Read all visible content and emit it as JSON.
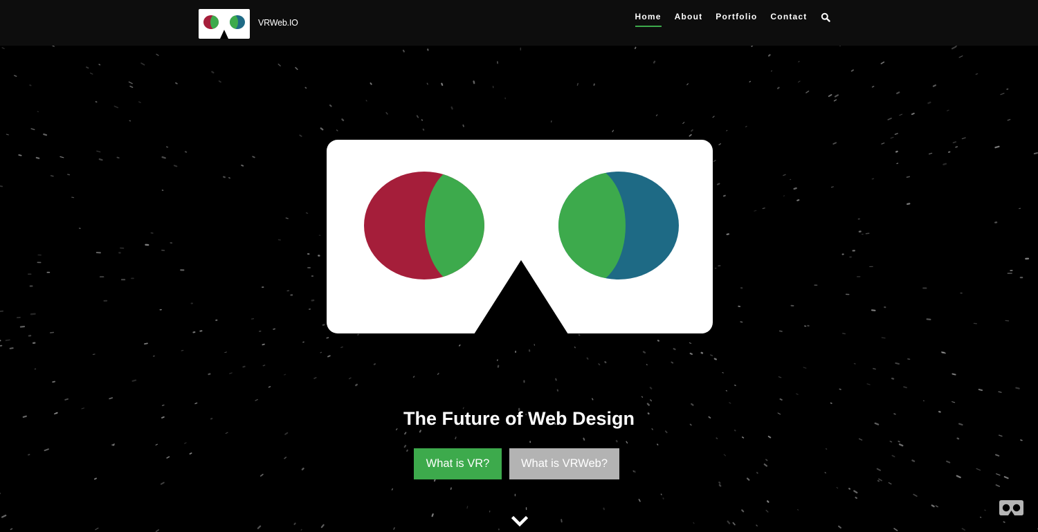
{
  "header": {
    "brand": "VRWeb.IO",
    "logo_icon": "vr-headset-logo-icon",
    "nav": [
      {
        "label": "Home",
        "active": true
      },
      {
        "label": "About",
        "active": false
      },
      {
        "label": "Portfolio",
        "active": false
      },
      {
        "label": "Contact",
        "active": false
      }
    ],
    "search_icon": "search-icon"
  },
  "hero": {
    "logo_icon": "vr-headset-logo-icon",
    "tagline": "The Future of Web Design",
    "buttons": [
      {
        "label": "What is VR?",
        "color": "#3daa4c"
      },
      {
        "label": "What is VRWeb?",
        "color": "#b3b3b3"
      }
    ],
    "scroll_icon": "chevron-down-icon"
  },
  "vr_toggle_icon": "cardboard-vr-icon",
  "colors": {
    "background": "#000000",
    "header": "#0d0d0d",
    "accent_green": "#3daa4c",
    "lens_red": "#a51e3a",
    "lens_blue": "#1e6a85",
    "button_gray": "#b3b3b3"
  }
}
